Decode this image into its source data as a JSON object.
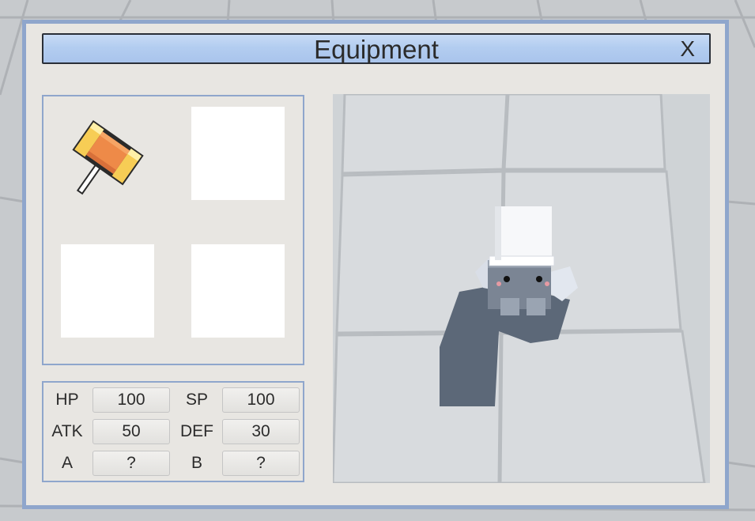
{
  "window": {
    "title": "Equipment",
    "close_label": "X"
  },
  "equipment_slots": [
    {
      "item": "hammer-icon",
      "filled": true
    },
    {
      "item": "",
      "filled": false
    },
    {
      "item": "",
      "filled": false
    },
    {
      "item": "",
      "filled": false
    }
  ],
  "stats": {
    "hp": {
      "label": "HP",
      "value": "100"
    },
    "sp": {
      "label": "SP",
      "value": "100"
    },
    "atk": {
      "label": "ATK",
      "value": "50"
    },
    "def": {
      "label": "DEF",
      "value": "30"
    },
    "a": {
      "label": "A",
      "value": "?"
    },
    "b": {
      "label": "B",
      "value": "?"
    }
  },
  "colors": {
    "window_border": "#8fa6cc",
    "panel_bg": "#e8e6e2",
    "title_bar": "#b3cdf0",
    "hammer_head": "#ee8a48",
    "hammer_caps": "#f7cd55"
  }
}
